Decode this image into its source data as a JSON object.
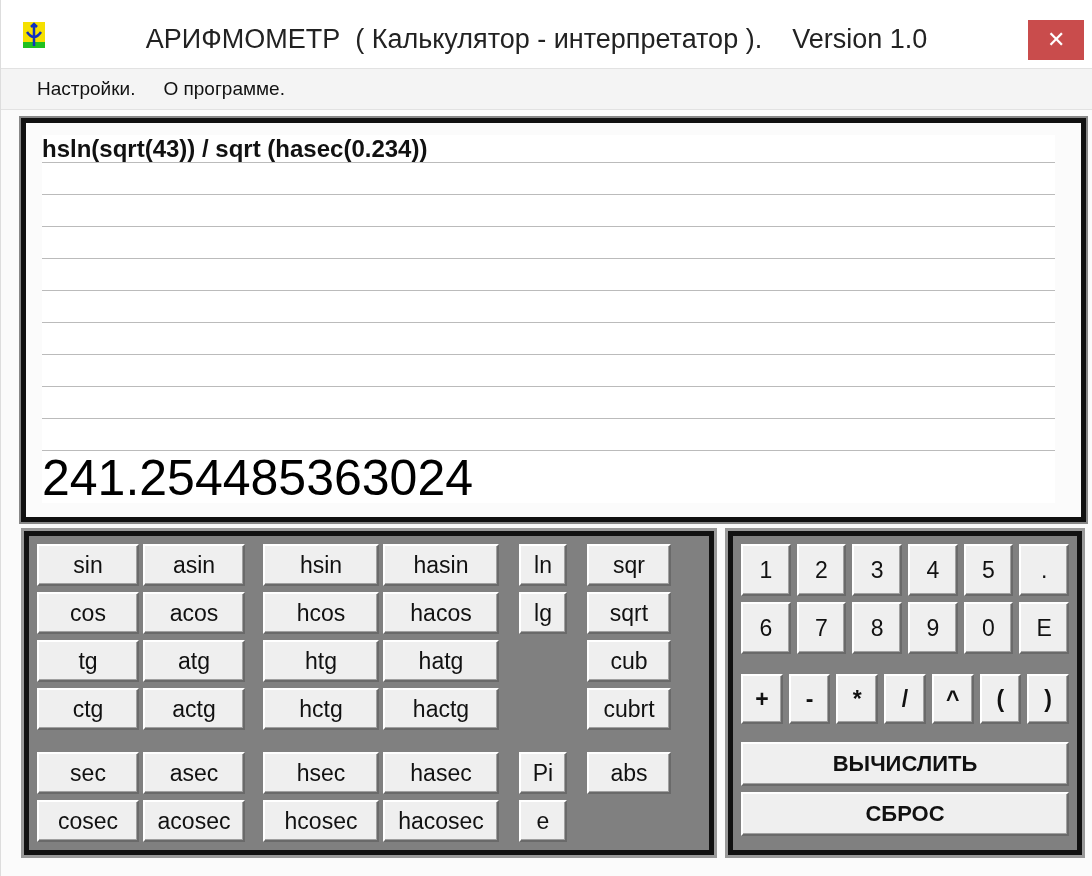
{
  "window": {
    "title": "АРИФМОМЕТР  ( Калькулятор - интерпретатор ).    Version 1.0",
    "close": "✕"
  },
  "menu": [
    "Настройки.",
    "О программе."
  ],
  "display": {
    "expression": "hsln(sqrt(43)) / sqrt (hasec(0.234))",
    "result": "241.254485363024"
  },
  "function_keys": {
    "sections": [
      {
        "columns": [
          [
            "sin",
            "cos",
            "tg",
            "ctg"
          ],
          [
            "asin",
            "acos",
            "atg",
            "actg"
          ],
          [
            "hsin",
            "hcos",
            "htg",
            "hctg"
          ],
          [
            "hasin",
            "hacos",
            "hatg",
            "hactg"
          ],
          [
            "ln",
            "lg"
          ],
          [
            "sqr",
            "sqrt",
            "cub",
            "cubrt"
          ]
        ]
      },
      {
        "columns": [
          [
            "sec",
            "cosec"
          ],
          [
            "asec",
            "acosec"
          ],
          [
            "hsec",
            "hcosec"
          ],
          [
            "hasec",
            "hacosec"
          ],
          [
            "Pi",
            "e"
          ],
          [
            "abs"
          ]
        ]
      }
    ]
  },
  "number_keys": {
    "digit_rows": [
      [
        "1",
        "2",
        "3",
        "4",
        "5",
        "."
      ],
      [
        "6",
        "7",
        "8",
        "9",
        "0",
        "E"
      ]
    ],
    "operators": [
      "+",
      "-",
      "*",
      "/",
      "^",
      "(",
      ")"
    ],
    "actions": [
      "ВЫЧИСЛИТЬ",
      "СБРОС"
    ]
  }
}
